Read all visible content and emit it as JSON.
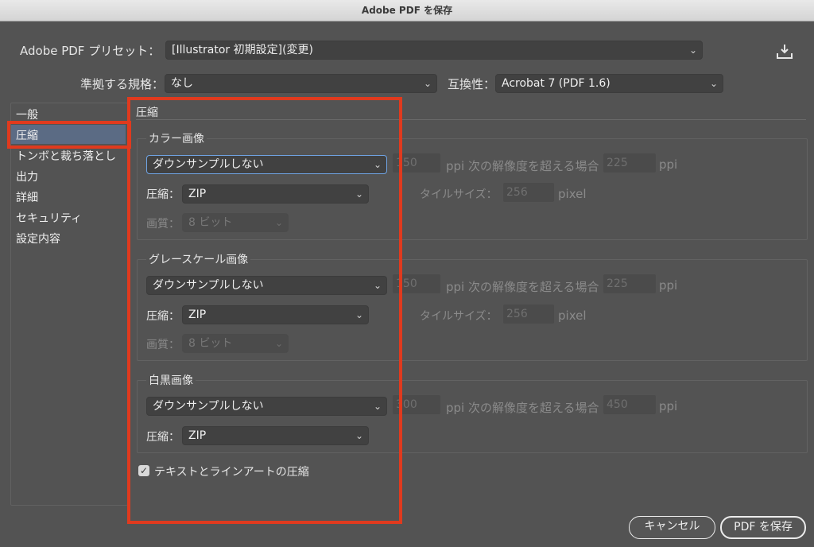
{
  "window": {
    "title": "Adobe PDF を保存"
  },
  "preset": {
    "label": "Adobe PDF プリセット：",
    "value": "[Illustrator 初期設定](変更)"
  },
  "standard": {
    "label": "準拠する規格：",
    "value": "なし"
  },
  "compat": {
    "label": "互換性：",
    "value": "Acrobat 7 (PDF 1.6)"
  },
  "sidebar": {
    "items": [
      {
        "label": "一般"
      },
      {
        "label": "圧縮"
      },
      {
        "label": "トンボと裁ち落とし"
      },
      {
        "label": "出力"
      },
      {
        "label": "詳細"
      },
      {
        "label": "セキュリティ"
      },
      {
        "label": "設定内容"
      }
    ]
  },
  "compression": {
    "title": "圧縮",
    "color": {
      "title": "カラー画像",
      "downsample": "ダウンサンプルしない",
      "ppi_value": "150",
      "ppi_text": "ppi 次の解像度を超える場合",
      "above_value": "225",
      "ppi_unit": "ppi",
      "comp_label": "圧縮：",
      "comp_value": "ZIP",
      "tile_label": "タイルサイズ：",
      "tile_value": "256",
      "tile_unit": "pixel",
      "quality_label": "画質：",
      "quality_value": "8 ビット"
    },
    "gray": {
      "title": "グレースケール画像",
      "downsample": "ダウンサンプルしない",
      "ppi_value": "150",
      "ppi_text": "ppi 次の解像度を超える場合",
      "above_value": "225",
      "ppi_unit": "ppi",
      "comp_label": "圧縮：",
      "comp_value": "ZIP",
      "tile_label": "タイルサイズ：",
      "tile_value": "256",
      "tile_unit": "pixel",
      "quality_label": "画質：",
      "quality_value": "8 ビット"
    },
    "mono": {
      "title": "白黒画像",
      "downsample": "ダウンサンプルしない",
      "ppi_value": "300",
      "ppi_text": "ppi 次の解像度を超える場合",
      "above_value": "450",
      "ppi_unit": "ppi",
      "comp_label": "圧縮：",
      "comp_value": "ZIP"
    },
    "text_art_label": "テキストとラインアートの圧縮",
    "text_art_checked": true
  },
  "buttons": {
    "cancel": "キャンセル",
    "save": "PDF を保存"
  },
  "icons": {
    "save_preset": "download-icon",
    "chevron": "chevron-down-icon",
    "check": "checkmark-icon"
  },
  "colors": {
    "highlight": "#e03a1e",
    "selected_item": "#5b6b84",
    "focus": "#6fa3e3"
  }
}
